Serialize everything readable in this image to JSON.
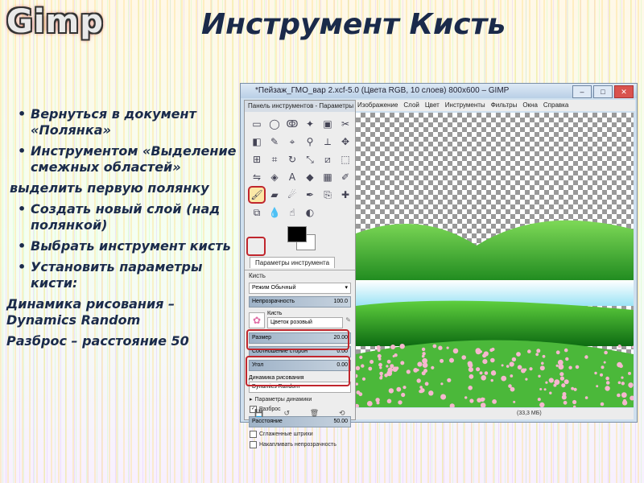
{
  "slide": {
    "logo": "Gimp",
    "title": "Инструмент Кисть",
    "bullets": [
      {
        "kind": "li",
        "text": "Вернуться в документ «Полянка»"
      },
      {
        "kind": "li",
        "text": "Инструментом «Выделение смежных областей»"
      },
      {
        "kind": "plain",
        "text": "выделить первую полянку"
      },
      {
        "kind": "li",
        "text": "Создать новый слой (над полянкой)"
      },
      {
        "kind": "li",
        "text": "Выбрать инструмент кисть"
      },
      {
        "kind": "li",
        "text": "Установить параметры кисти:"
      },
      {
        "kind": "plain0",
        "text": "Динамика рисования – Dynamics Random"
      },
      {
        "kind": "plain0",
        "text": "Разброс – расстояние 50"
      }
    ]
  },
  "window": {
    "title": "*Пейзаж_ГМО_вар 2.xcf-5.0 (Цвета RGB, 10 слоев) 800x600 – GIMP",
    "controls": [
      "–",
      "□",
      "✕"
    ],
    "menu": [
      "Изображение",
      "Слой",
      "Цвет",
      "Инструменты",
      "Фильтры",
      "Окна",
      "Справка"
    ],
    "status": "(33,3 МБ)"
  },
  "toolbox": {
    "title": "Панель инструментов - Параметры",
    "close": "✕",
    "tools": [
      {
        "name": "rect-select-icon",
        "glyph": "▭"
      },
      {
        "name": "ellipse-select-icon",
        "glyph": "◯"
      },
      {
        "name": "lasso-icon",
        "glyph": "ↂ"
      },
      {
        "name": "fuzzy-select-icon",
        "glyph": "✦"
      },
      {
        "name": "color-select-icon",
        "glyph": "▣"
      },
      {
        "name": "scissors-icon",
        "glyph": "✂"
      },
      {
        "name": "foreground-select-icon",
        "glyph": "◧"
      },
      {
        "name": "paths-icon",
        "glyph": "✎"
      },
      {
        "name": "color-picker-icon",
        "glyph": "⌖"
      },
      {
        "name": "zoom-icon",
        "glyph": "⚲"
      },
      {
        "name": "measure-icon",
        "glyph": "⟂"
      },
      {
        "name": "move-icon",
        "glyph": "✥"
      },
      {
        "name": "align-icon",
        "glyph": "⊞"
      },
      {
        "name": "crop-icon",
        "glyph": "⌗"
      },
      {
        "name": "rotate-icon",
        "glyph": "↻"
      },
      {
        "name": "scale-icon",
        "glyph": "⤡"
      },
      {
        "name": "shear-icon",
        "glyph": "⧄"
      },
      {
        "name": "perspective-icon",
        "glyph": "⬚"
      },
      {
        "name": "flip-icon",
        "glyph": "⇋"
      },
      {
        "name": "cage-icon",
        "glyph": "◈"
      },
      {
        "name": "text-icon",
        "glyph": "A"
      },
      {
        "name": "bucket-fill-icon",
        "glyph": "◆"
      },
      {
        "name": "blend-icon",
        "glyph": "▦"
      },
      {
        "name": "pencil-icon",
        "glyph": "✐"
      },
      {
        "name": "paintbrush-icon",
        "glyph": "🖌",
        "selected": true
      },
      {
        "name": "eraser-icon",
        "glyph": "▰"
      },
      {
        "name": "airbrush-icon",
        "glyph": "☄"
      },
      {
        "name": "ink-icon",
        "glyph": "✒"
      },
      {
        "name": "clone-icon",
        "glyph": "⎘"
      },
      {
        "name": "heal-icon",
        "glyph": "✚"
      },
      {
        "name": "perspective-clone-icon",
        "glyph": "⧉"
      },
      {
        "name": "blur-icon",
        "glyph": "💧"
      },
      {
        "name": "smudge-icon",
        "glyph": "☝"
      },
      {
        "name": "dodge-icon",
        "glyph": "◐"
      }
    ],
    "options_tab": "Параметры инструмента",
    "section": "Кисть",
    "mode_label": "Режим",
    "mode_value": "Обычный",
    "opacity_label": "Непрозрачность",
    "opacity_value": "100.0",
    "brush_label": "Кисть",
    "brush_value": "Цветок розовый",
    "size_label": "Размер",
    "size_value": "20.00",
    "aspect_label": "Соотношение сторон",
    "aspect_value": "0.00",
    "angle_label": "Угол",
    "angle_value": "0.00",
    "dynamics_label": "Динамика рисования",
    "dynamics_value": "Dynamics Random",
    "dynamics_params": "Параметры динамики",
    "jitter_label": "Разброс",
    "distance_label": "Расстояние",
    "distance_value": "50.00",
    "smooth_label": "Сглаженные штрихи",
    "incremental_label": "Накапливать непрозрачность",
    "footer": [
      "💾",
      "↺",
      "🗑",
      "⟲"
    ]
  }
}
